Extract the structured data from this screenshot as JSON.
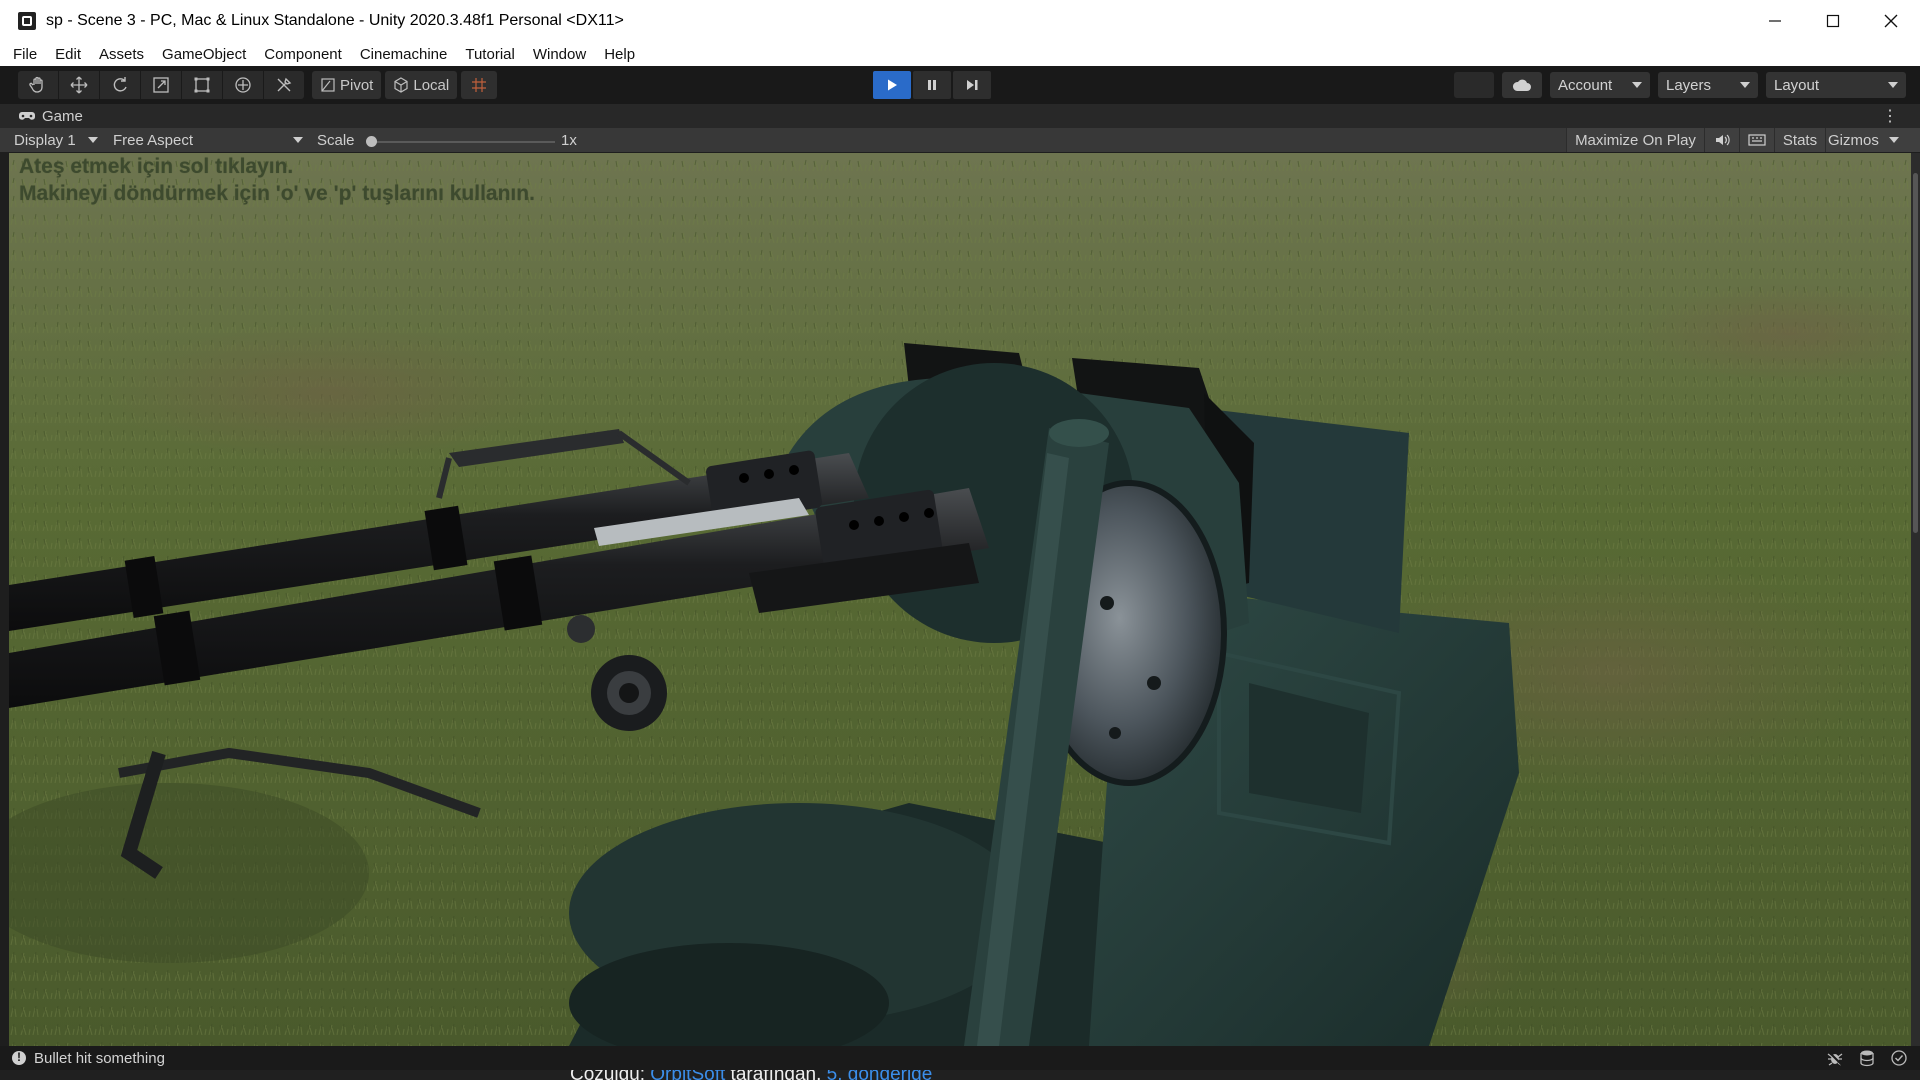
{
  "window": {
    "title": "sp - Scene 3 - PC, Mac & Linux Standalone - Unity 2020.3.48f1 Personal <DX11>",
    "controls": [
      "minimize-icon",
      "maximize-icon",
      "close-icon"
    ]
  },
  "menu": {
    "items": [
      "File",
      "Edit",
      "Assets",
      "GameObject",
      "Component",
      "Cinemachine",
      "Tutorial",
      "Window",
      "Help"
    ]
  },
  "toolbar": {
    "tools": [
      "hand-tool-icon",
      "move-tool-icon",
      "rotate-tool-icon",
      "scale-tool-icon",
      "rect-tool-icon",
      "transform-tool-icon",
      "custom-tool-icon"
    ],
    "pivot_label": "Pivot",
    "local_label": "Local",
    "play_controls": [
      "play-icon",
      "pause-icon",
      "step-icon"
    ],
    "account_label": "Account",
    "layers_label": "Layers",
    "layout_label": "Layout"
  },
  "game_view": {
    "tab_label": "Game",
    "display_label": "Display 1",
    "aspect_label": "Free Aspect",
    "scale_label": "Scale",
    "scale_value": "1x",
    "maximize_label": "Maximize On Play",
    "stats_label": "Stats",
    "gizmos_label": "Gizmos",
    "hint_line1": "Ateş etmek için sol tıklayın.",
    "hint_line2": "Makineyi döndürmek için 'o' ve 'p' tuşlarını kullanın."
  },
  "status": {
    "message": "Bullet hit something"
  },
  "underlying": {
    "text_prefix": "Çözüldü:",
    "link1": "OrbitSoft",
    "text_mid": "tarafından.",
    "link2": "5. gönderide"
  },
  "colors": {
    "play_active": "#2a6bc9",
    "grass": "#5a6b38",
    "turret": "#27403d"
  }
}
